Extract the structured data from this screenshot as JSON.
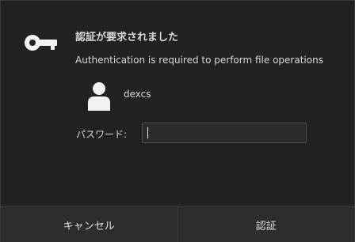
{
  "dialog": {
    "title": "認証が要求されました",
    "message": "Authentication is required to perform file operations",
    "user": {
      "name": "dexcs",
      "avatar_icon": "user-avatar-icon"
    },
    "password": {
      "label": "パスワード:",
      "value": ""
    },
    "buttons": {
      "cancel_label": "キャンセル",
      "authenticate_label": "認証"
    },
    "icon": "key-icon"
  },
  "colors": {
    "background": "#222222",
    "text": "#d8d8d8",
    "button_bg": "#2d2d2d",
    "input_border": "#4e4e4e"
  }
}
